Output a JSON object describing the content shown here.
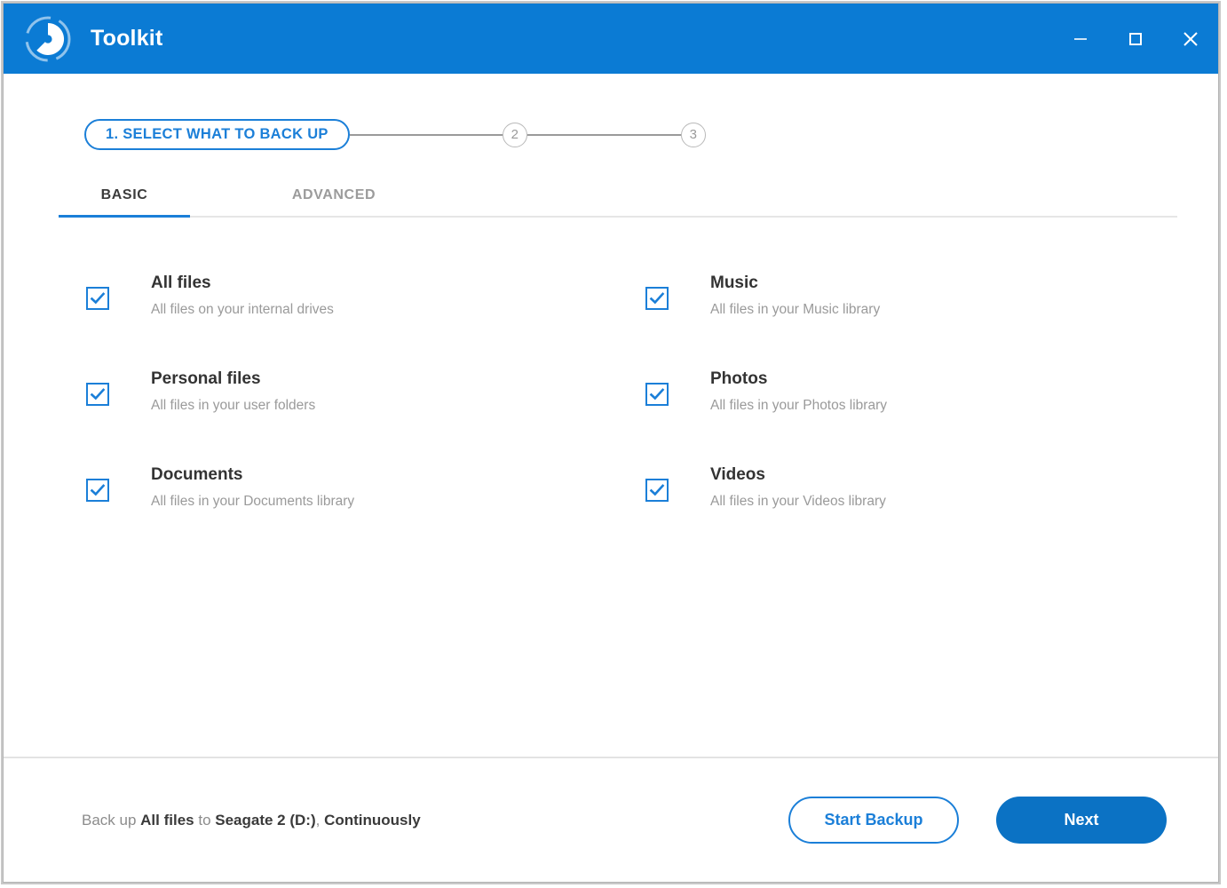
{
  "window": {
    "title": "Toolkit",
    "logo_icon": "seagate-toolkit-logo",
    "controls": {
      "minimize": "minimize-icon",
      "maximize": "maximize-icon",
      "close": "close-icon"
    }
  },
  "steps": {
    "current": {
      "label": "1. SELECT WHAT TO BACK UP"
    },
    "two": "2",
    "three": "3"
  },
  "tabs": [
    {
      "label": "BASIC",
      "active": true
    },
    {
      "label": "ADVANCED",
      "active": false
    }
  ],
  "options": [
    {
      "title": "All files",
      "subtitle": "All files on your internal drives",
      "checked": true
    },
    {
      "title": "Music",
      "subtitle": "All files in your Music library",
      "checked": true
    },
    {
      "title": "Personal files",
      "subtitle": "All files in your user folders",
      "checked": true
    },
    {
      "title": "Photos",
      "subtitle": "All files in your Photos library",
      "checked": true
    },
    {
      "title": "Documents",
      "subtitle": "All files in your Documents library",
      "checked": true
    },
    {
      "title": "Videos",
      "subtitle": "All files in your Videos library",
      "checked": true
    }
  ],
  "footer": {
    "status": {
      "prefix": "Back up ",
      "what": "All files",
      "middle": " to ",
      "destination": "Seagate 2 (D:)",
      "separator": ", ",
      "schedule": "Continuously"
    },
    "start_backup_label": "Start Backup",
    "next_label": "Next"
  },
  "colors": {
    "accent": "#0b7bd4",
    "accent_border": "#1b7fd8",
    "next_button": "#0b72c4",
    "title_text": "#333333",
    "subtitle_text": "#9a9a9a"
  }
}
